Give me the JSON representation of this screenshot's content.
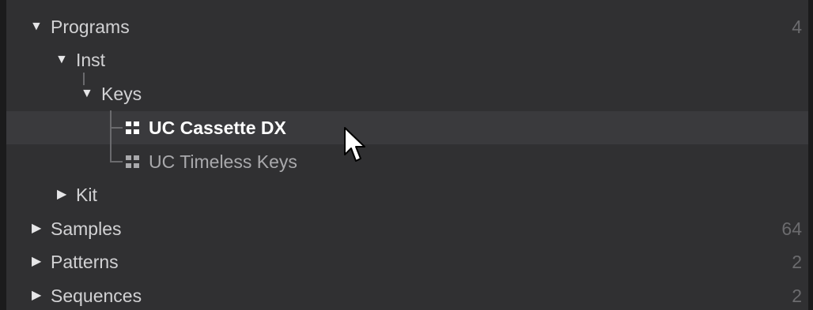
{
  "browser": {
    "programs": {
      "label": "Programs",
      "count": "4",
      "arrow": "▼"
    },
    "inst": {
      "label": "Inst",
      "arrow": "▼"
    },
    "keys": {
      "label": "Keys",
      "arrow": "▼"
    },
    "cassette": {
      "label": "UC Cassette DX",
      "icon": "program-grid-icon"
    },
    "timeless": {
      "label": "UC Timeless Keys",
      "icon": "program-grid-icon"
    },
    "kit": {
      "label": "Kit",
      "arrow": "▶"
    },
    "samples": {
      "label": "Samples",
      "count": "64",
      "arrow": "▶"
    },
    "patterns": {
      "label": "Patterns",
      "count": "2",
      "arrow": "▶"
    },
    "sequences": {
      "label": "Sequences",
      "count": "2",
      "arrow": "▶"
    }
  },
  "colors": {
    "background": "#303032",
    "highlight_row": "#3a3a3d",
    "selected_text": "#ffffff",
    "text": "#d2d2d4",
    "count_text": "#6b6b6e"
  }
}
